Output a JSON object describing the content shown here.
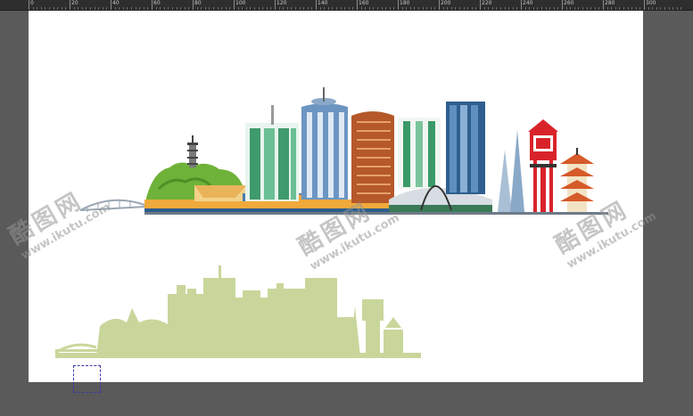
{
  "ruler": {
    "labels": [
      "0",
      "20",
      "40",
      "60",
      "80",
      "100",
      "120",
      "140",
      "160",
      "180",
      "200",
      "220",
      "240",
      "260",
      "280",
      "300"
    ]
  },
  "colors": {
    "workspace": "#5a5a5a",
    "artboard": "#ffffff",
    "silhouette": "#c9d69b",
    "tower_red": "#d9232a",
    "glass_blue": "#5b86b5",
    "copper": "#b5582a",
    "green_glass": "#4fa47a",
    "tree_green": "#7bbd3f"
  },
  "watermarks": [
    {
      "brand": "酷图网",
      "url": "www.ikutu.com"
    },
    {
      "brand": "酷图网",
      "url": "www.ikutu.com"
    },
    {
      "brand": "酷图网",
      "url": "www.ikutu.com"
    }
  ]
}
